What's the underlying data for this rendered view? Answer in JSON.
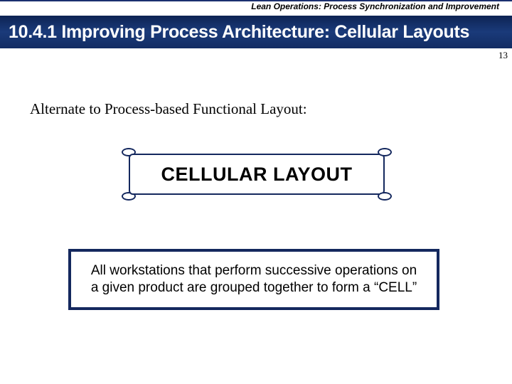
{
  "chapter": "Lean Operations: Process Synchronization and Improvement",
  "title": "10.4.1 Improving Process Architecture: Cellular Layouts",
  "pageNumber": "13",
  "introText": "Alternate to Process-based Functional Layout:",
  "scrollLabel": "CELLULAR LAYOUT",
  "definition": "All workstations that perform successive operations on a given product are grouped together to form a “CELL”"
}
